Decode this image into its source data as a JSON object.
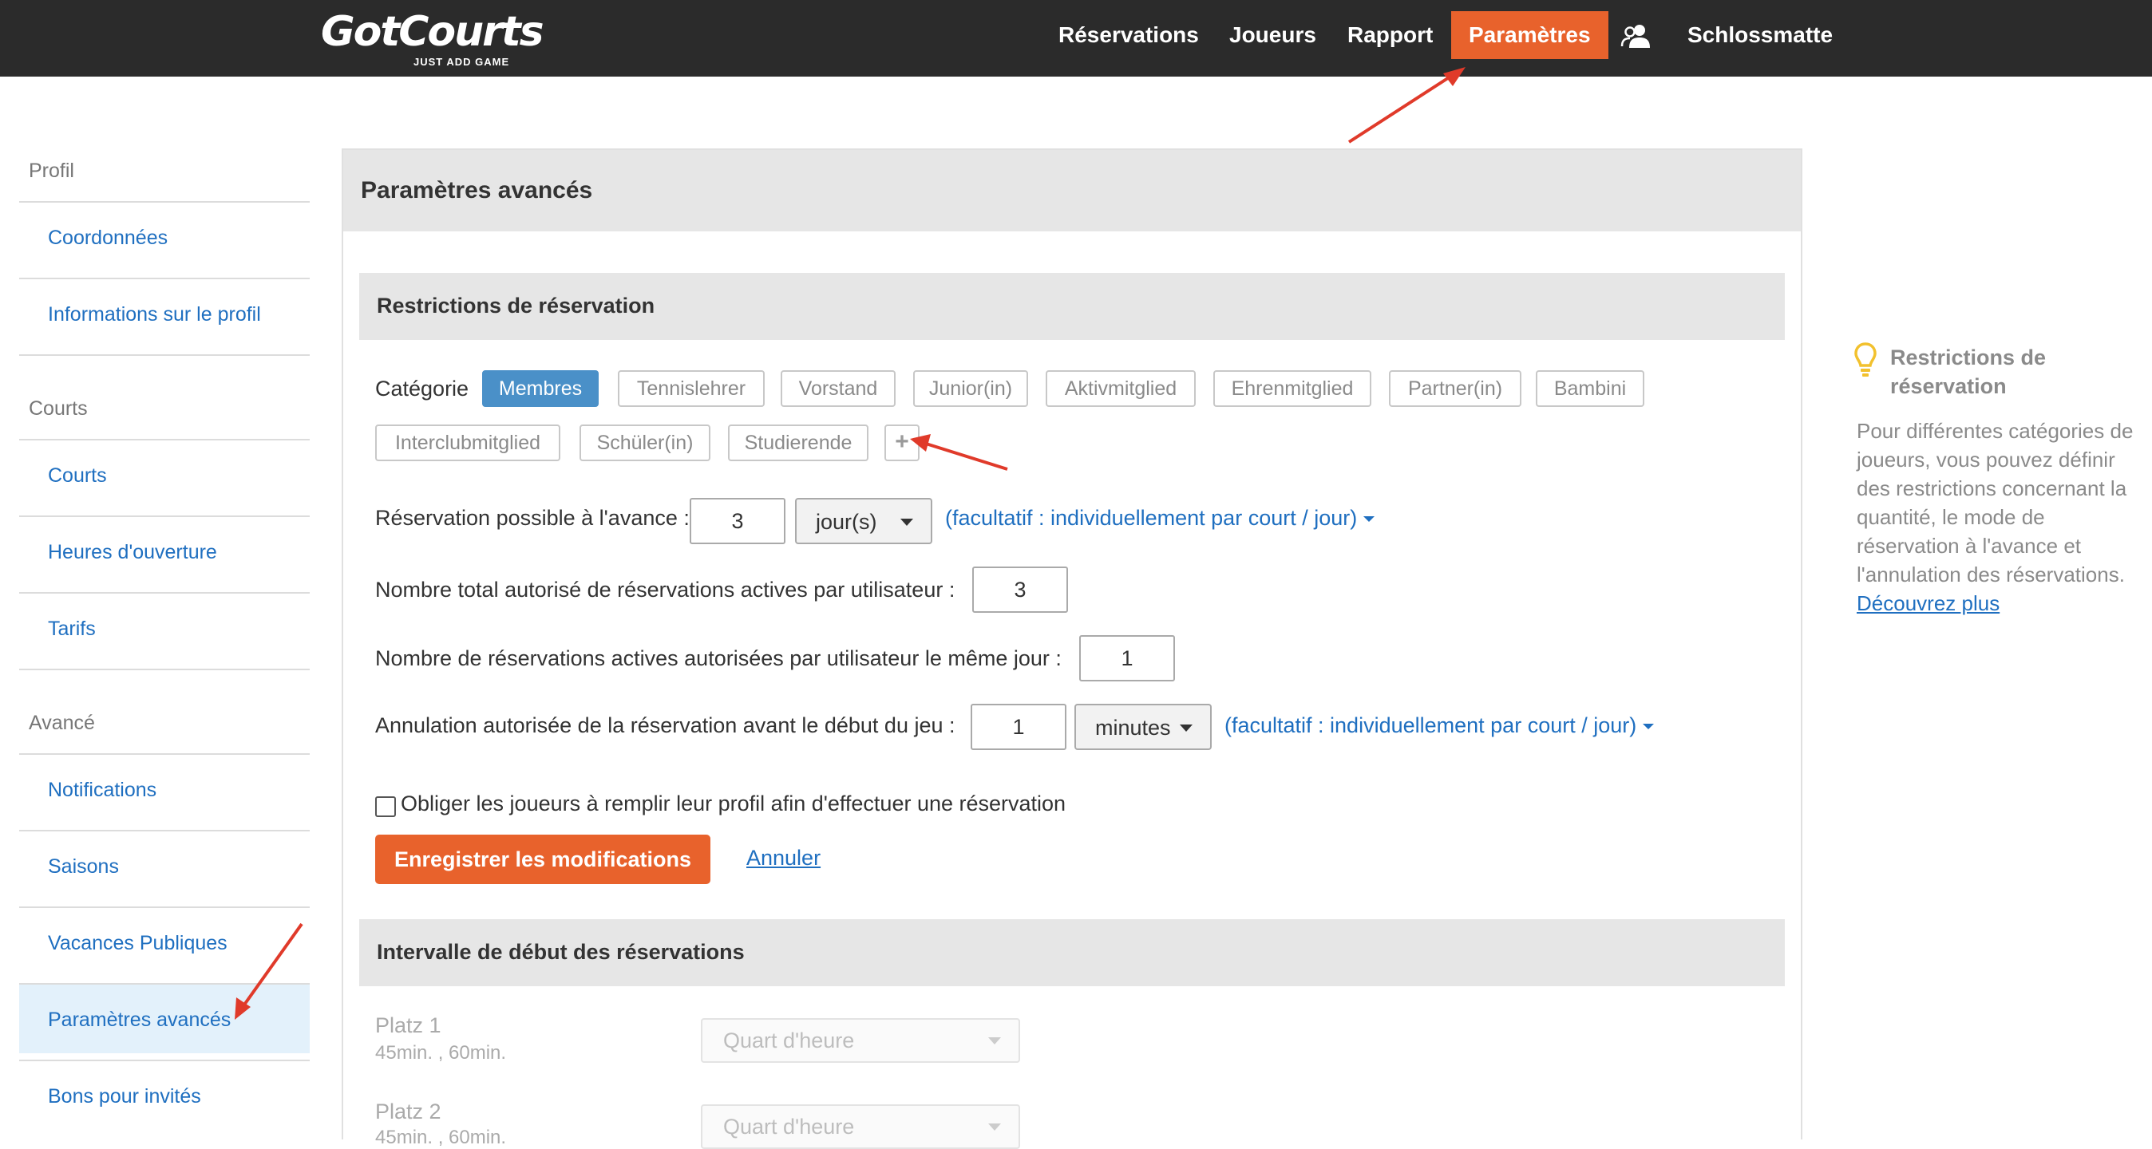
{
  "brand": {
    "name": "GotCourts",
    "tagline": "JUST ADD GAME"
  },
  "nav": {
    "items": [
      "Réservations",
      "Joueurs",
      "Rapport",
      "Paramètres"
    ],
    "active": "Paramètres",
    "club": "Schlossmatte",
    "icon": "users-icon"
  },
  "sidebar": {
    "sections": [
      {
        "title": "Profil",
        "items": [
          "Coordonnées",
          "Informations sur le profil"
        ]
      },
      {
        "title": "Courts",
        "items": [
          "Courts",
          "Heures d'ouverture",
          "Tarifs"
        ]
      },
      {
        "title": "Avancé",
        "items": [
          "Notifications",
          "Saisons",
          "Vacances Publiques",
          "Paramètres avancés",
          "Bons pour invités"
        ]
      }
    ],
    "active": "Paramètres avancés"
  },
  "main": {
    "title": "Paramètres avancés",
    "restrictions": {
      "title": "Restrictions de réservation",
      "category_label": "Catégorie",
      "categories": [
        "Membres",
        "Tennislehrer",
        "Vorstand",
        "Junior(in)",
        "Aktivmitglied",
        "Ehrenmitglied",
        "Partner(in)",
        "Bambini",
        "Interclubmitglied",
        "Schüler(in)",
        "Studierende"
      ],
      "active_category": "Membres",
      "advance_label": "Réservation possible à l'avance :",
      "advance_value": "3",
      "advance_unit": "jour(s)",
      "optional_link": "(facultatif : individuellement par court / jour)",
      "total_label": "Nombre total autorisé de réservations actives par utilisateur :",
      "total_value": "3",
      "same_day_label": "Nombre de réservations actives autorisées par utilisateur le même jour :",
      "same_day_value": "1",
      "cancel_label": "Annulation autorisée de la réservation avant le début du jeu :",
      "cancel_value": "1",
      "cancel_unit": "minutes",
      "profile_check_label": "Obliger les joueurs à remplir leur profil afin d'effectuer une réservation",
      "profile_check_checked": false,
      "save_label": "Enregistrer les modifications",
      "cancel_link": "Annuler"
    },
    "interval": {
      "title": "Intervalle de début des réservations",
      "courts": [
        {
          "name": "Platz 1",
          "durations": "45min. , 60min.",
          "select": "Quart d'heure"
        },
        {
          "name": "Platz 2",
          "durations": "45min. , 60min.",
          "select": "Quart d'heure"
        }
      ]
    }
  },
  "tip": {
    "title": "Restrictions de réservation",
    "text": "Pour différentes catégories de joueurs, vous pouvez définir des restrictions concernant la quantité, le mode de réservation à l'avance et l'annulation des réservations.",
    "link": "Découvrez plus"
  },
  "colors": {
    "accent": "#e8622c",
    "link": "#1f6fc0",
    "chip_active": "#4a90c8",
    "topbar": "#2b2b2b"
  }
}
